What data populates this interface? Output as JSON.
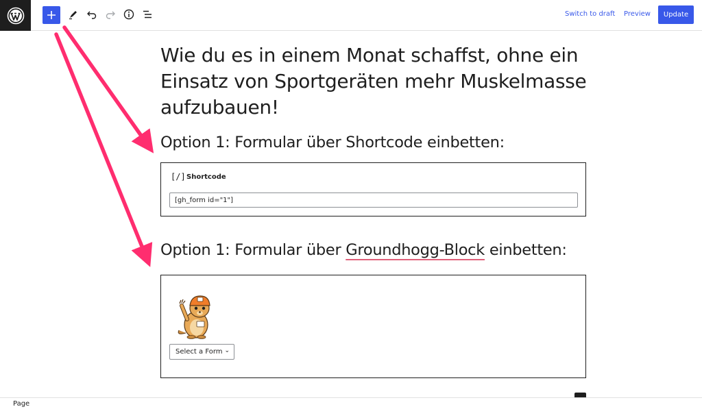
{
  "toolbar": {
    "switch_draft": "Switch to draft",
    "preview": "Preview",
    "update": "Update"
  },
  "post": {
    "title": "Wie du es in einem Monat schaffst, ohne ein Einsatz von Sportgeräten mehr Muskelmasse aufzubauen!",
    "heading1": "Option 1: Formular über Shortcode einbetten:",
    "heading2_prefix": "Option 1: Formular über ",
    "heading2_link": "Groundhogg-Block",
    "heading2_suffix": " einbetten:"
  },
  "shortcode_block": {
    "icon_text": "[/]",
    "label": "Shortcode",
    "value": "[gh_form id=\"1\"]"
  },
  "groundhogg_block": {
    "select_label": "Select a Form"
  },
  "footer": {
    "breadcrumb": "Page"
  },
  "colors": {
    "accent": "#3858e9",
    "arrow": "#ff2d6f"
  }
}
